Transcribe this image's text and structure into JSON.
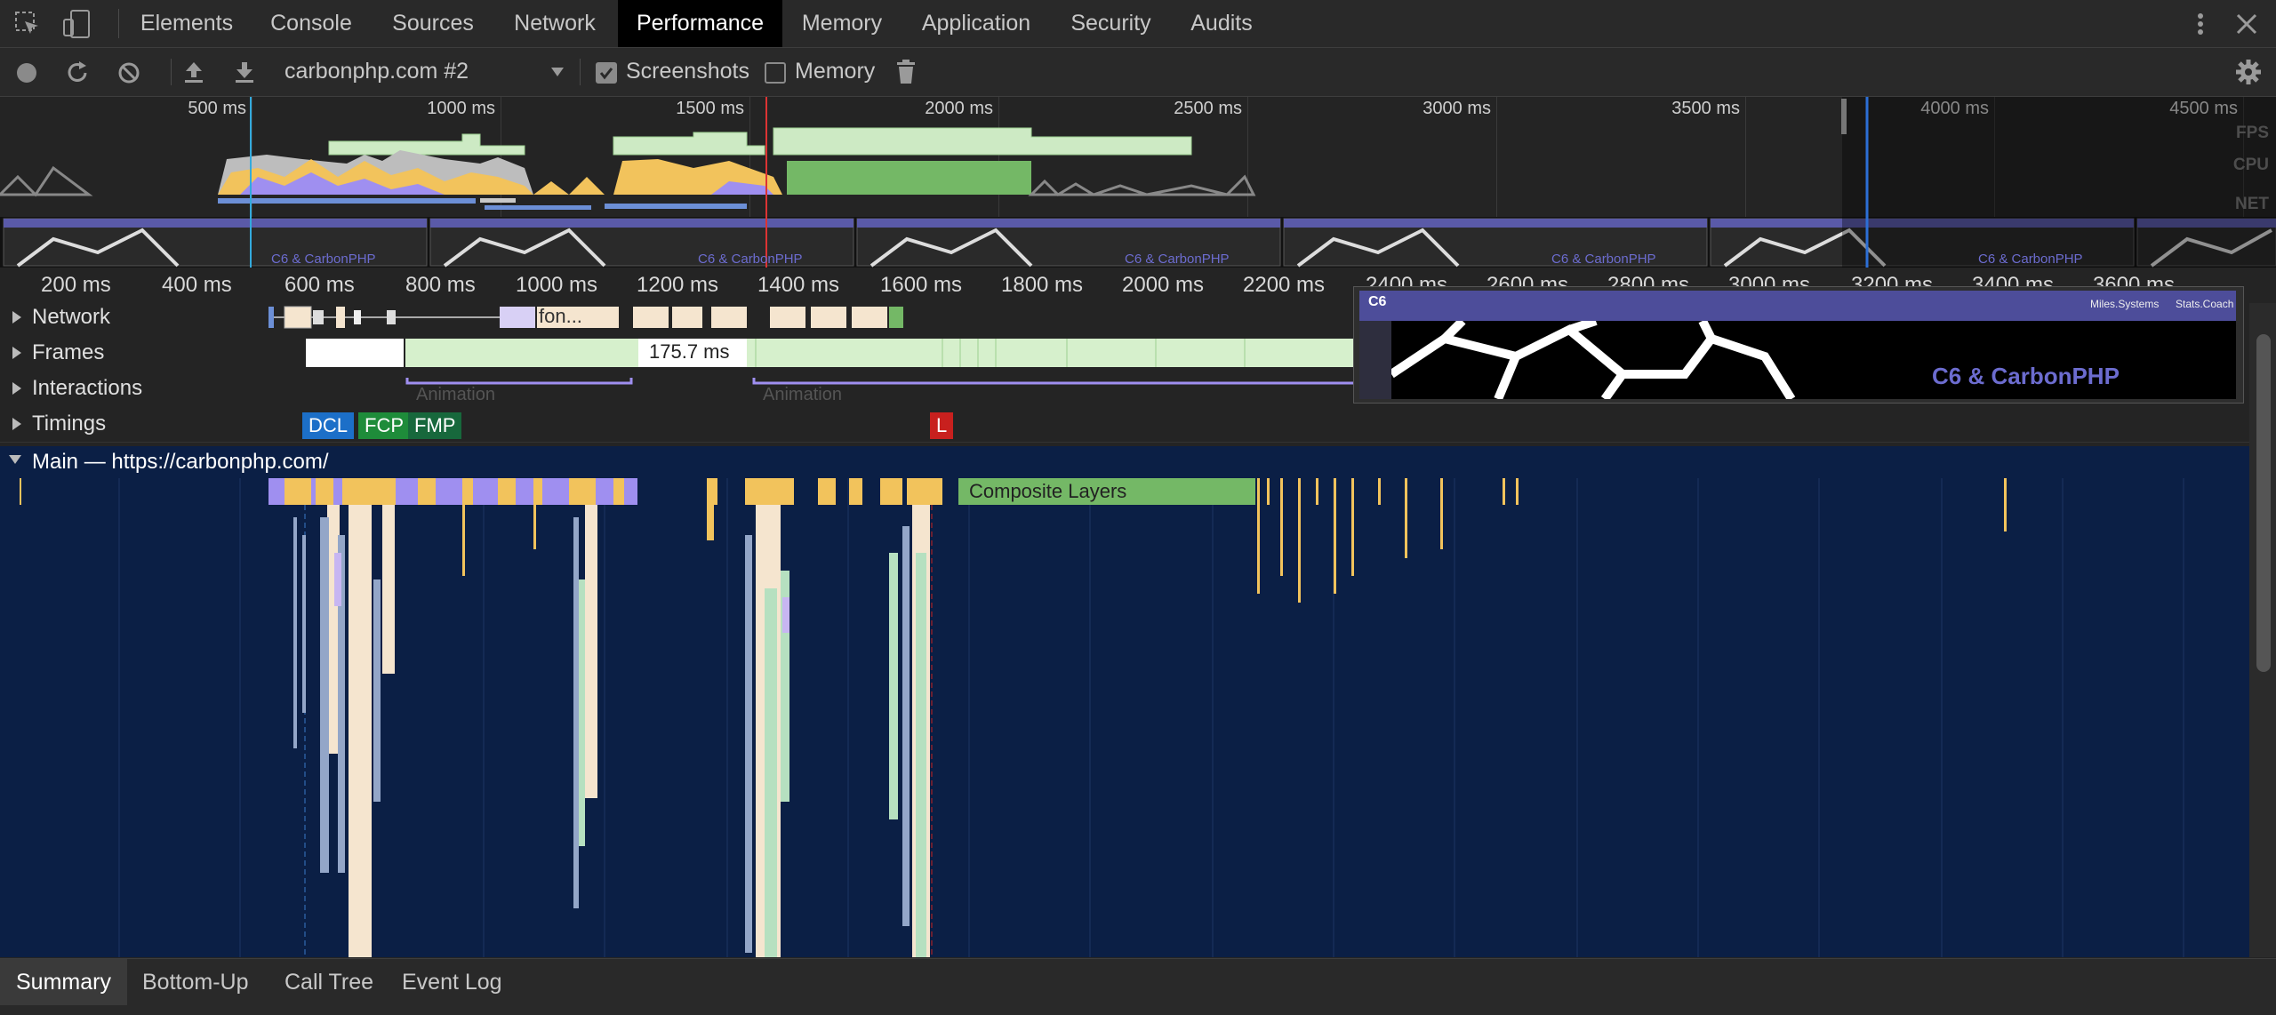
{
  "tabs": [
    "Elements",
    "Console",
    "Sources",
    "Network",
    "Performance",
    "Memory",
    "Application",
    "Security",
    "Audits"
  ],
  "active_tab": "Performance",
  "toolbar": {
    "profile_select": "carbonphp.com #2",
    "screenshots_label": "Screenshots",
    "screenshots_checked": true,
    "memory_label": "Memory",
    "memory_checked": false
  },
  "overview": {
    "ticks": [
      "500 ms",
      "1000 ms",
      "1500 ms",
      "2000 ms",
      "2500 ms",
      "3000 ms",
      "3500 ms",
      "4000 ms",
      "4500 ms"
    ],
    "fps_label": "FPS",
    "cpu_label": "CPU",
    "net_label": "NET",
    "filmstrip_caption": "C6 & CarbonPHP"
  },
  "ruler": [
    "200 ms",
    "400 ms",
    "600 ms",
    "800 ms",
    "1000 ms",
    "1200 ms",
    "1400 ms",
    "1600 ms",
    "1800 ms",
    "2000 ms",
    "2200 ms",
    "2400 ms",
    "2600 ms",
    "2800 ms",
    "3000 ms",
    "3200 ms",
    "3400 ms",
    "3600 ms"
  ],
  "tracks": {
    "network": "Network",
    "network_item": "fon...",
    "frames": "Frames",
    "frame_duration": "175.7 ms",
    "interactions": "Interactions",
    "animation_label": "Animation",
    "timings": "Timings",
    "main": "Main — https://carbonphp.com/"
  },
  "timings": {
    "dcl": "DCL",
    "fcp": "FCP",
    "fmp": "FMP",
    "l": "L"
  },
  "main_track": {
    "composite_label": "Composite Layers"
  },
  "tooltip": {
    "brand": "C6",
    "nav1": "Miles.Systems",
    "nav2": "Stats.Coach",
    "caption": "C6 & CarbonPHP"
  },
  "bottom_tabs": [
    "Summary",
    "Bottom-Up",
    "Call Tree",
    "Event Log"
  ],
  "active_bottom_tab": "Summary",
  "colors": {
    "scripting": "#f2c35c",
    "rendering": "#b38ef7",
    "painting": "#74c07b",
    "main_bg": "#0b1f45",
    "dcl": "#1c6fc8",
    "fcp": "#1e8c3a",
    "fmp": "#17683c",
    "load": "#c8201e"
  }
}
